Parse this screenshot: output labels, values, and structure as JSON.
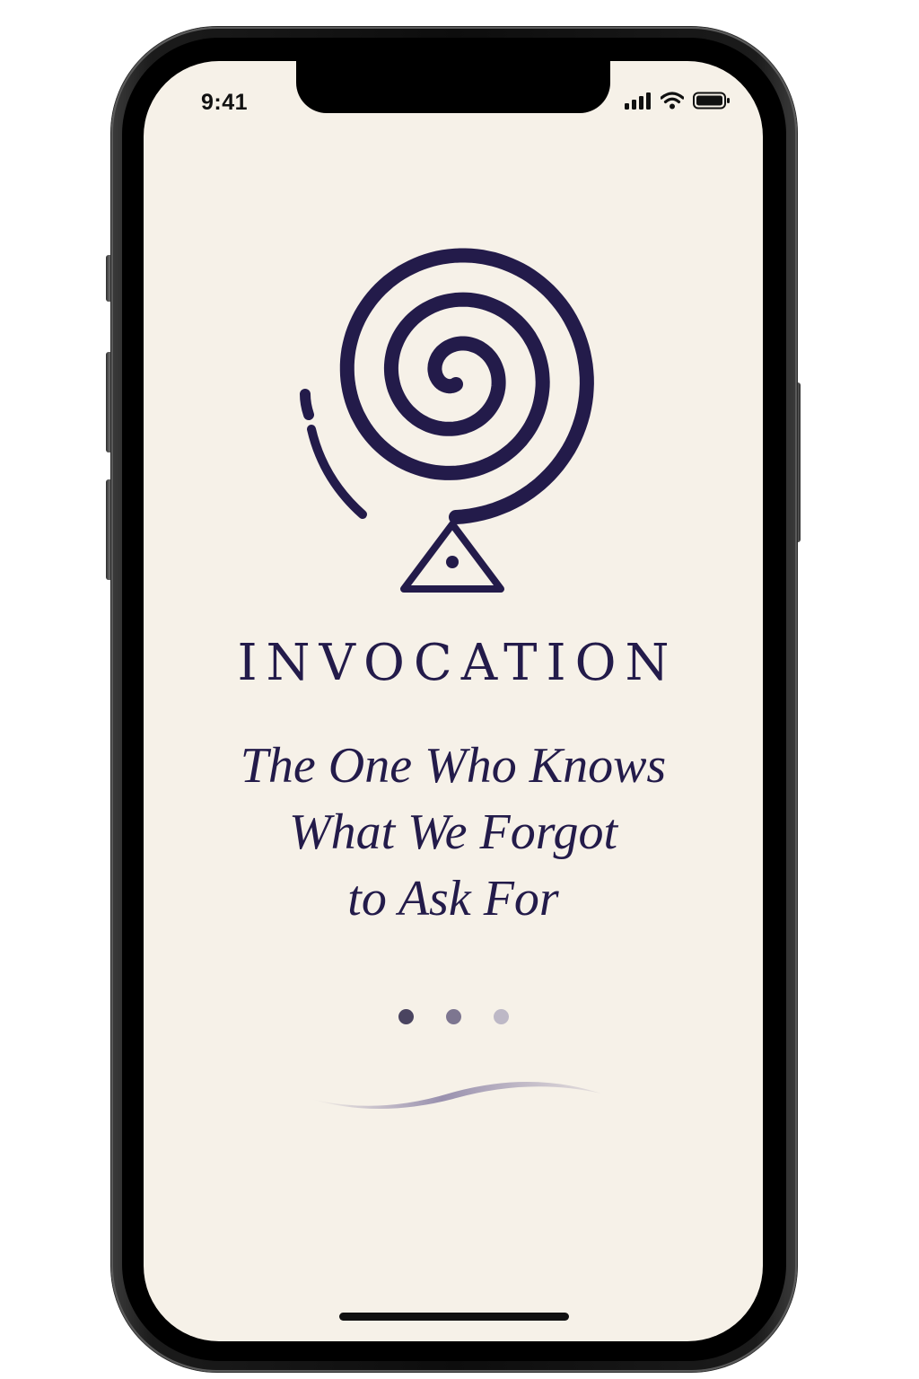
{
  "status_bar": {
    "time": "9:41",
    "icons": [
      "cellular-signal-icon",
      "wifi-icon",
      "battery-icon"
    ]
  },
  "emblem": {
    "icon": "spiral-eye-triangle-icon",
    "color": "#231b4a"
  },
  "app_title": "INVOCATION",
  "tagline": {
    "line1": "The One Who Knows",
    "line2": "What We Forgot",
    "line3": "to Ask For"
  },
  "pagination": {
    "total_pages": 3,
    "current_page": 1
  },
  "colors": {
    "background": "#f6f1e8",
    "primary": "#231b4a",
    "swoosh": "#8f86a8"
  }
}
